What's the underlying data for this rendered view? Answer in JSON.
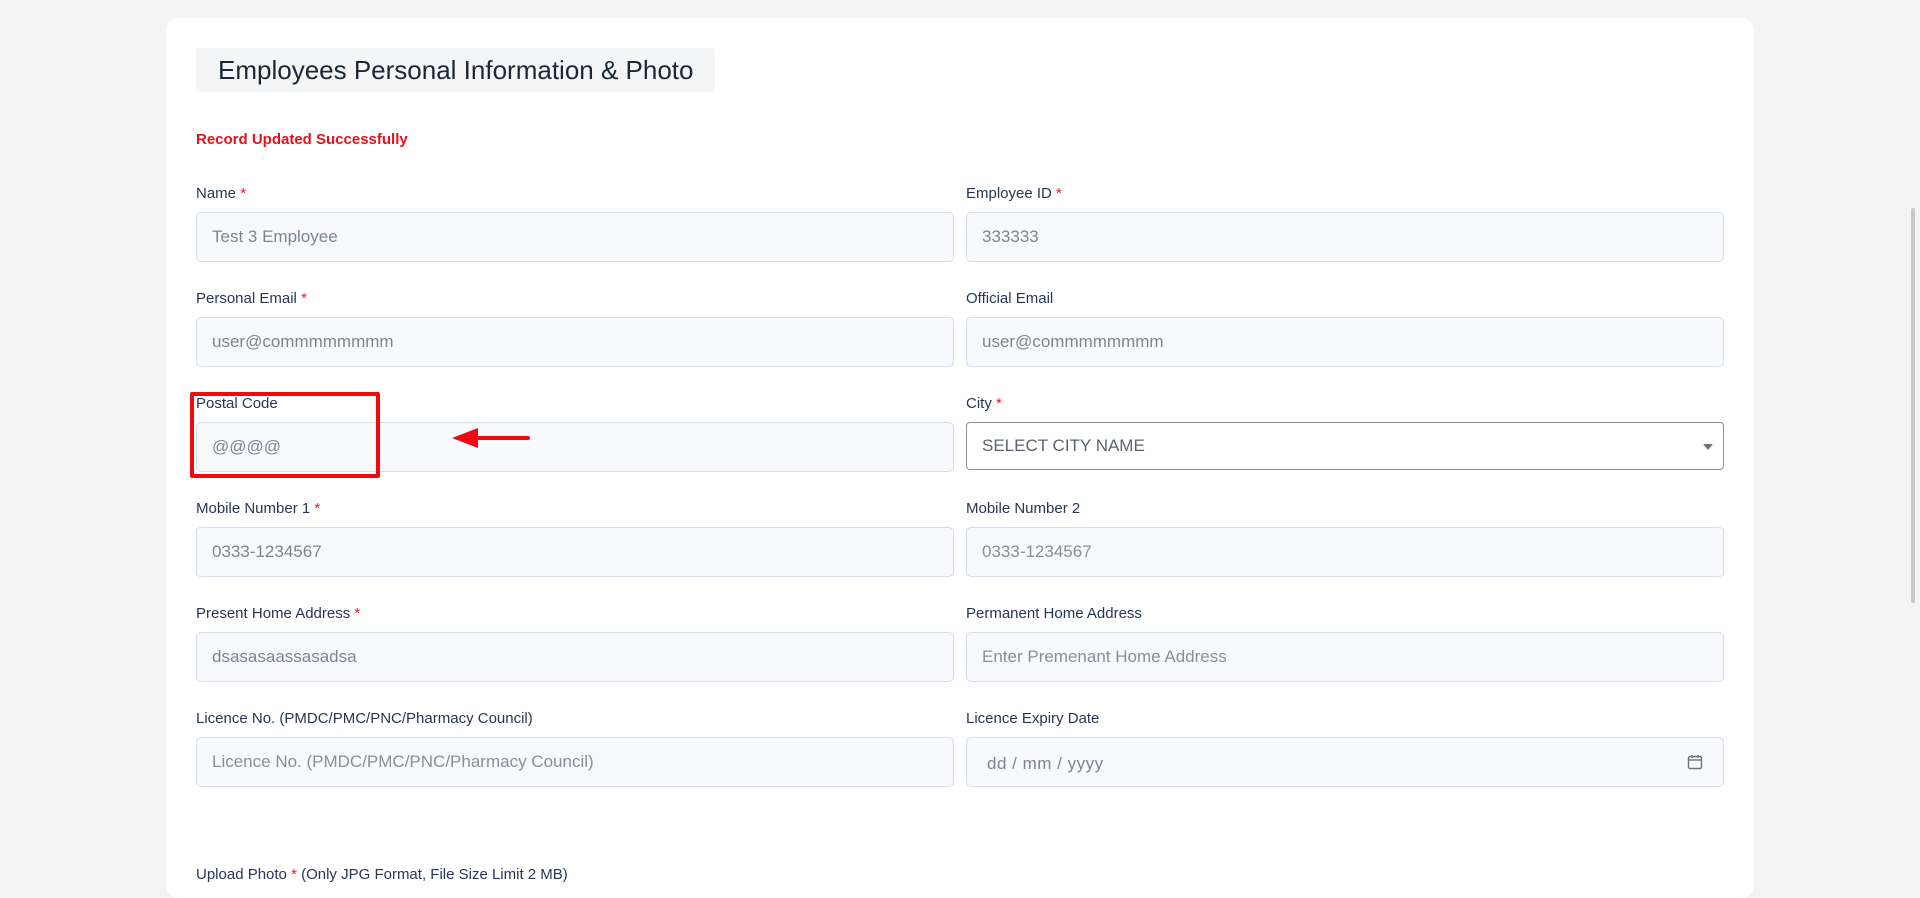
{
  "section_title": "Employees Personal Information & Photo",
  "status_message": "Record Updated Successfully",
  "required_marker": "*",
  "fields": {
    "name": {
      "label": "Name",
      "value": "Test 3 Employee"
    },
    "employee_id": {
      "label": "Employee ID",
      "value": "333333"
    },
    "personal_email": {
      "label": "Personal Email",
      "value": "user@commmmmmmm"
    },
    "official_email": {
      "label": "Official Email",
      "value": "user@commmmmmmm"
    },
    "postal_code": {
      "label": "Postal Code",
      "value": "@@@@"
    },
    "city": {
      "label": "City",
      "selected": "SELECT CITY NAME"
    },
    "mobile_1": {
      "label": "Mobile Number 1",
      "value": "0333-1234567"
    },
    "mobile_2": {
      "label": "Mobile Number 2",
      "placeholder": "0333-1234567"
    },
    "present_address": {
      "label": "Present Home Address",
      "value": "dsasasaassasadsa"
    },
    "permanent_address": {
      "label": "Permanent Home Address",
      "placeholder": "Enter Premenant Home Address"
    },
    "licence_no": {
      "label": "Licence No. (PMDC/PMC/PNC/Pharmacy Council)",
      "placeholder": "Licence No. (PMDC/PMC/PNC/Pharmacy Council)"
    },
    "licence_expiry": {
      "label": "Licence Expiry Date",
      "placeholder": "dd / mm / yyyy"
    }
  },
  "upload": {
    "label": "Upload Photo",
    "note": "(Only JPG Format, File Size Limit 2 MB)"
  },
  "colors": {
    "status": "#e8101a",
    "annotation": "#ef0a10",
    "required": "#e0192f"
  },
  "icons": {
    "calendar": "calendar-icon",
    "dropdown": "chevron-down-icon",
    "annotation_arrow": "arrow-left-icon"
  }
}
